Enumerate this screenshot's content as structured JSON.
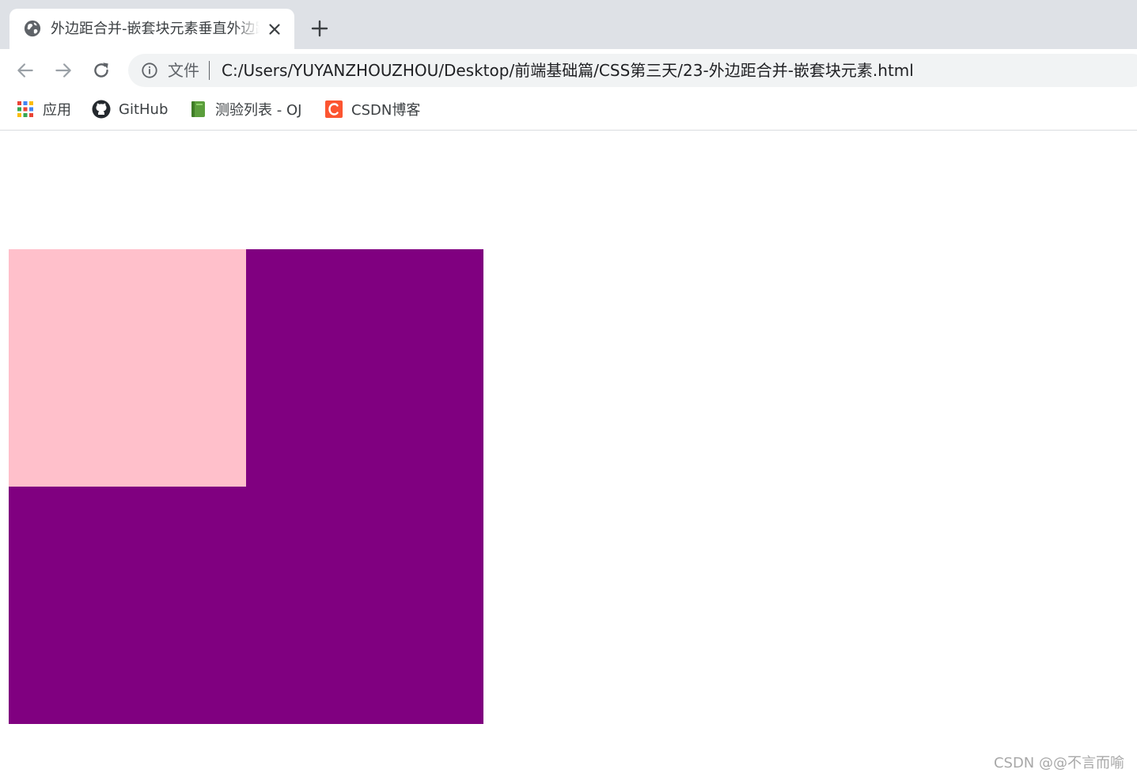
{
  "browser": {
    "tab": {
      "title": "外边距合并-嵌套块元素垂直外边距塌陷",
      "favicon": "globe-icon",
      "close_icon": "close-icon"
    },
    "new_tab_icon": "plus-icon",
    "toolbar": {
      "back_icon": "arrow-left-icon",
      "forward_icon": "arrow-right-icon",
      "reload_icon": "reload-icon"
    },
    "omnibox": {
      "info_icon": "info-icon",
      "scheme_label": "文件",
      "url": "C:/Users/YUYANZHOUZHOU/Desktop/前端基础篇/CSS第三天/23-外边距合并-嵌套块元素.html"
    },
    "bookmarks": [
      {
        "label": "应用",
        "icon": "apps-grid-icon"
      },
      {
        "label": "GitHub",
        "icon": "github-icon"
      },
      {
        "label": "测验列表 - OJ",
        "icon": "book-icon"
      },
      {
        "label": "CSDN博客",
        "icon": "csdn-icon"
      }
    ]
  },
  "page": {
    "father_color": "#800080",
    "son_color": "#ffc0cb"
  },
  "watermark": "CSDN @@不言而喻"
}
